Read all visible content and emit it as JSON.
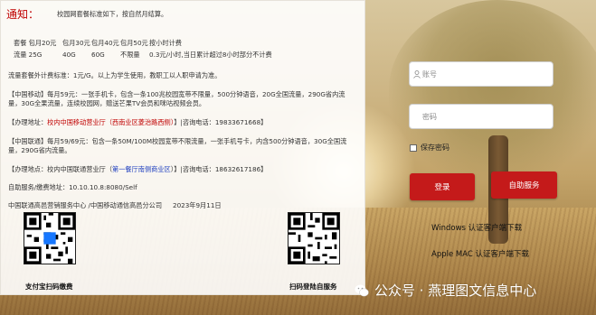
{
  "notice": {
    "title": "通知：",
    "subtitle": "校园网套餐标准如下，按自然月结算。",
    "broadband_label": "套餐 包月20元",
    "broadband_items": [
      "包月30元",
      "包月40元",
      "包月50元",
      "按小时计费"
    ],
    "traffic_label": "流量 25G",
    "traffic_items": [
      "40G",
      "60G",
      "不限量",
      "0.3元/小时,当日累计超过8小时部分不计费"
    ],
    "extra_rule": "流量套餐外计费标准：1元/G。以上为学生使用，教职工以人职申请为准。",
    "mobile_desc": "【中国移动】每月59元：一张手机卡，包含一条100兆校园宽带不限量，500分钟语音，20G全国流量，290G省内流量，30G全果流量，连续校园网，赠送芒果TV会员和咪咕视频会员。",
    "mobile_office_prefix": "【办理地址：",
    "mobile_office_red": "校内中国移动营业厅（西南业区菱治路西侧）",
    "mobile_office_suffix": "】|咨询电话：19833671668】",
    "unicom_desc": "【中国联通】每月59/69元：包含一条50M/100M校园宽带不限流量，一张手机号卡，内含500分钟语音，30G全国流量，290G省内流量。",
    "unicom_office_prefix": "【办理地点：校内中国联通营业厅（",
    "unicom_office_blue": "第一餐厅南侧商业区",
    "unicom_office_suffix": "）】|咨询电话：18632617186】",
    "self_service": "自助服务/缴费地址：10.10.10.8:8080/Self",
    "footer_org": "中国联通高邑营销服务中心 /中国移动通信高邑分公司",
    "footer_date": "2023年9月11日",
    "qr_left_label": "支付宝扫码缴费",
    "qr_right_label": "扫码登陆自服务"
  },
  "login": {
    "username_placeholder": "账号",
    "password_placeholder": "密码",
    "remember_label": "保存密码",
    "login_button": "登录",
    "self_service_button": "自助服务",
    "windows_download": "Windows 认证客户端下载",
    "mac_download": "Apple MAC 认证客户端下载"
  },
  "watermark": "公众号 · 燕理图文信息中心",
  "colors": {
    "accent_red": "#c41a1a",
    "notice_red": "#c00000",
    "link_blue": "#1f3fbf"
  }
}
